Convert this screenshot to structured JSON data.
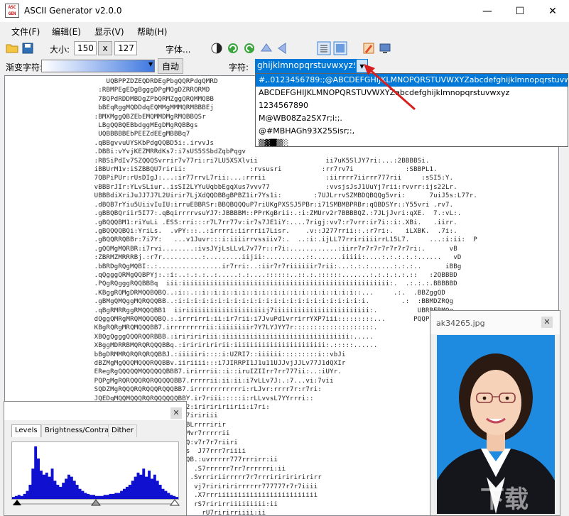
{
  "app": {
    "title": "ASCII Generator v2.0.0",
    "icon_text": "ASC\nGEN"
  },
  "window_controls": {
    "minimize": "—",
    "maximize": "☐",
    "close": "✕"
  },
  "menu": [
    "文件(F)",
    "编辑(E)",
    "显示(V)",
    "帮助(H)"
  ],
  "toolbar": {
    "size_label": "大小:",
    "width": "150",
    "x_label": "x",
    "height": "127",
    "font_button": "字体..."
  },
  "row2": {
    "gradient_label": "渐变字符:",
    "auto_button": "自动",
    "chars_label": "字符:",
    "chars_value": "ghijklmnopqrstuvwxyz$"
  },
  "chars_dropdown": {
    "options": [
      "#,.0123456789:;@ABCDEFGHIJKLMNOPQRSTUVWXYZabcdefghijklmnopqrstuvwxyz$",
      "ABCDEFGHIJKLMNOPQRSTUVWXYZabcdefghijklmnopqrstuvwxyz",
      "1234567890",
      "M@WB08Za2SX7r;i:;.",
      "@#MBHAGh93X25Sisr;:,",
      "▒▓█▒░"
    ],
    "selected_index": 0
  },
  "ascii_lines": [
    "                         UQBPPZDZEQDRDEgPbgQQRPdgQMRD",
    "                       :RBMPEgEDgBgggDPgMQgDZRRQRMD",
    "                       7BQPdRDDMBDgZPbQRMZggQRQMMQBB",
    "                       bBEqRggMQDDdqEQMMgMMMQRMBBBEj",
    "                      :BMXMggQBZEbEMQMMDMgRMQBBQSr",
    "                       LBgQQBQEBbdggMEgDMgRQBBgs",
    "                       UQBBBBBEbPEEZdEEgMBBBq7",
    "                      .qBBgvvuUYSKbPdgQQBD5i:.irvvJs",
    "                      .DBBi:vYvjKEZMRRdKs7:i7sUS5SSbdZqbPqgv",
    "                      :RBSiPdIv7SZQQQSvrrir7v77ri:ri7LU5XSXlvii                 ii7uK5SlJY7ri:...:2BBBBSi.",
    "                      iBBUrM1v:iSZBBQU7ririi:                :rvsusri          :rr7rv7i             :SBBPL1.",
    "                      7QBPiPUr:rUsDIgJ:...:ir77rrvL7rii:...:rrrii               :iirrrr7iirrr777rii     :sSI5:Y.",
    "                      vBBBrJIr:YLvSLiur..isSI2LYYuUqbbEgqXus7vvv77              :vvsjsJsJ1UuYj7rii:rvvrr:ijs22Lr.",
    "                      UBBBdiXriJuJJ7J7L2Uirir7LjXdQQDBBgBPBZ1ir7Ys1i:        :7UJLrrvSZMBDQBQQg5vri:      7uiJ5s:L77r.",
    "                      .dBQB7rYiu5UiivIuIU:irruEBBRSr:BBQBQQQuP7riUKgPXSSJ5PBr:i71SMBMBPRBr:qQBDSYr::Y55vri .rv7.",
    "                      .gBBQBQriir5I77:.qBqirrrrvsuYJ7:JBBBBM::PPrKgBrii:.:i:ZMUrv2r7BBBBQZ.:7JLjJvri:qXE.  7.:vL:.",
    "                      .gBQQQBM1:riYuLi .ESS:rri:::r7L7rr77v:ir7s7JE1iY:....7rigj:vv7:r7vrr:ir7i::i:.XBi.   .iirr.",
    "                      .gBQQQQBQi:YriLs.  .vPY:::..:irrrri:iirrrii7Lisr.    .v::J277rrii::.:r7ri:.   iLXBK.  .7i:.",
    "                      .gBQQRRQBBr:7i7Y:   ...v1Juvr:::i:iiiirrvssiiv7:.  ..:i:.ijLL77rririiiirrL15L7.     ...:i:ii:  P",
    "                      .gQQMgMQRBR:i7rvi........:ivsJYjLsLLvL7v77r::r7i:............:iirr7r7r7r7r7r7r7ri:.      vB",
    "                      :ZBRMZMRRRBj.:r7r..........:.........iijii:..........::.......iiiii:....:.:.:.:.:......   vD",
    "                      .bBRDgRQgMQBI:.:................ir7rri:..:iir7r7riiiiiir7rii:...:.:.:......:.:.:..      iBBg",
    "                      .qQgggQRMgQQBPYj:.:i:..:.:.:..:.....:.:....::::::..::.:.::::::.......:.:.:.:.:.::   :2QBBBD",
    "                      .PQgRQgggRQQBBBq  iii:iiiiiiiiiiiiiiiiiiiiiiiiiiiiiiiiiiiiiiiiiiiiiiiiiiii:.  .:.:.:.BBBBBD",
    "                      .KBggRQMgDRMQQBQBQ..:i::.::i::i:i::i:i::i:i::i:i::i:i::i:i::i:i:i::...     .:.  .BBZggQD",
    "                      .gBMgQMQggMQRQQQBB..:i:i:i:i:i:i:i:i:i:i:i:i:i:i:i:i:i:i:i:i:i:i:i:i.        .:  :BBMDZRQg",
    "                      .qBgRMRRggRMQQQBB1  iiriiiiiiiiiiiiiiiiiiiij7iiiiiiiiiiiiiiiiiiiiiiii:.          UBRRERMQg",
    "                      dQggQMRgMRQMQQQQBQ.:.irrrirri:ii:ir7rii:i7JvuPd1vrrirrYXP7iii:::::::::...       PQQPR.DDD",
    "                      KBgRQRgMRQMQQQBB7.irrrrrrrrrii:iiiiiiiir7Y7LYJYY7r::::::::::::::::::::.",
    "                      XBQgQgggQQQRQQRBBB.:iririririii:iiiiiiiiiiiiiiiiiiiiiiiiiiiiiiii:.....",
    "                      XBggMDRRBMQRQRQQQBBq.:iriririririi:iiiiiiiiiiiiiiiiiiiiiii:.:::::......",
    "                      bBgDRMMRQRQRQRQQBBJ.:iiiiiri::::i:UZRI7::iiiiii:::::::::i::vbJi",
    "                      dBZMgMgQQQMQQQRQQBBv.iiriiii:::i7JIRRPI1J1u11UJJvjJJLv77J1dQXIr",
    "                      ERegRgQQQQQMQQQQQQBBB7.irirrrii::i::iruIZIIrr7rr777ii:..:iUYr.",
    "                      PQPgMgRQRQQQRQRQQQQQBB7.rrrrrii:ii:ii:i7vLLv7J:.:7...vi:7vii",
    "                      SQDZMgRQQQRQRQQQRQQQBB7.irrrrrrrrrrrri:rLJvr:rrrr7r:r7ri:",
    "                      JQEDgMQQMQQQRQRQQQQQQBBY.ir7riii:::::i:rLLvvsL7YYrrri::",
    "                      JQDdggQMRQRQRQQRQQQQQBB2:iririririirii:i7ri:",
    "                                    QQRMQQQBB7iririii",
    "                                    QRRRQQQBQBLrrrririr",
    "                                    QRRRQRBBBMvr7rrrrrii",
    "                                    QQRMQggQBQ:v7r7r7riiri",
    "                                    RQMQMQQBBs  J77rrr7riiii",
    "                                    QMQRRRQQQQB.:uvrrrrr777rrrirr:ii",
    "                                    MMRQQQZBB  .S7rrrrrr7rr7rrrrrri:ii",
    "                                    RRgPRBB   .Svrririirrrrr7r7rrririririririrr",
    "                                    BQggbDRBI  vj7ririririrrrrrr777777r7r7iiii",
    "                                    ggDDDQBP   .X7rrriiiiiiiiiiiiiiiiiiiiiiiii",
    "                                    ggDMgBQ.   rS7ririrriiiiiiiii:ii",
    "                                    gggQDRQB:    rU7ririrriiii:ii"
  ],
  "levels_window": {
    "tabs": [
      "Levels",
      "Brightness/Contrast",
      "Dither"
    ],
    "active_tab": "Levels",
    "histogram": [
      2,
      3,
      4,
      3,
      5,
      8,
      14,
      30,
      52,
      40,
      28,
      24,
      26,
      22,
      30,
      18,
      14,
      12,
      16,
      20,
      24,
      22,
      18,
      14,
      10,
      8,
      6,
      5,
      4,
      4,
      3,
      3,
      3,
      4,
      4,
      5,
      5,
      6,
      6,
      8,
      10,
      12,
      14,
      18,
      22,
      26,
      24,
      30,
      22,
      28,
      20,
      24,
      18,
      14,
      10,
      8,
      6,
      4,
      3,
      2
    ],
    "sliders": {
      "black": 0,
      "gray": 1.0,
      "white": 255
    },
    "histogram_color": "#1010d0"
  },
  "photo_window": {
    "title": "ak34265.jpg",
    "bg_color": "#1e8ae0"
  },
  "watermark": "下载"
}
